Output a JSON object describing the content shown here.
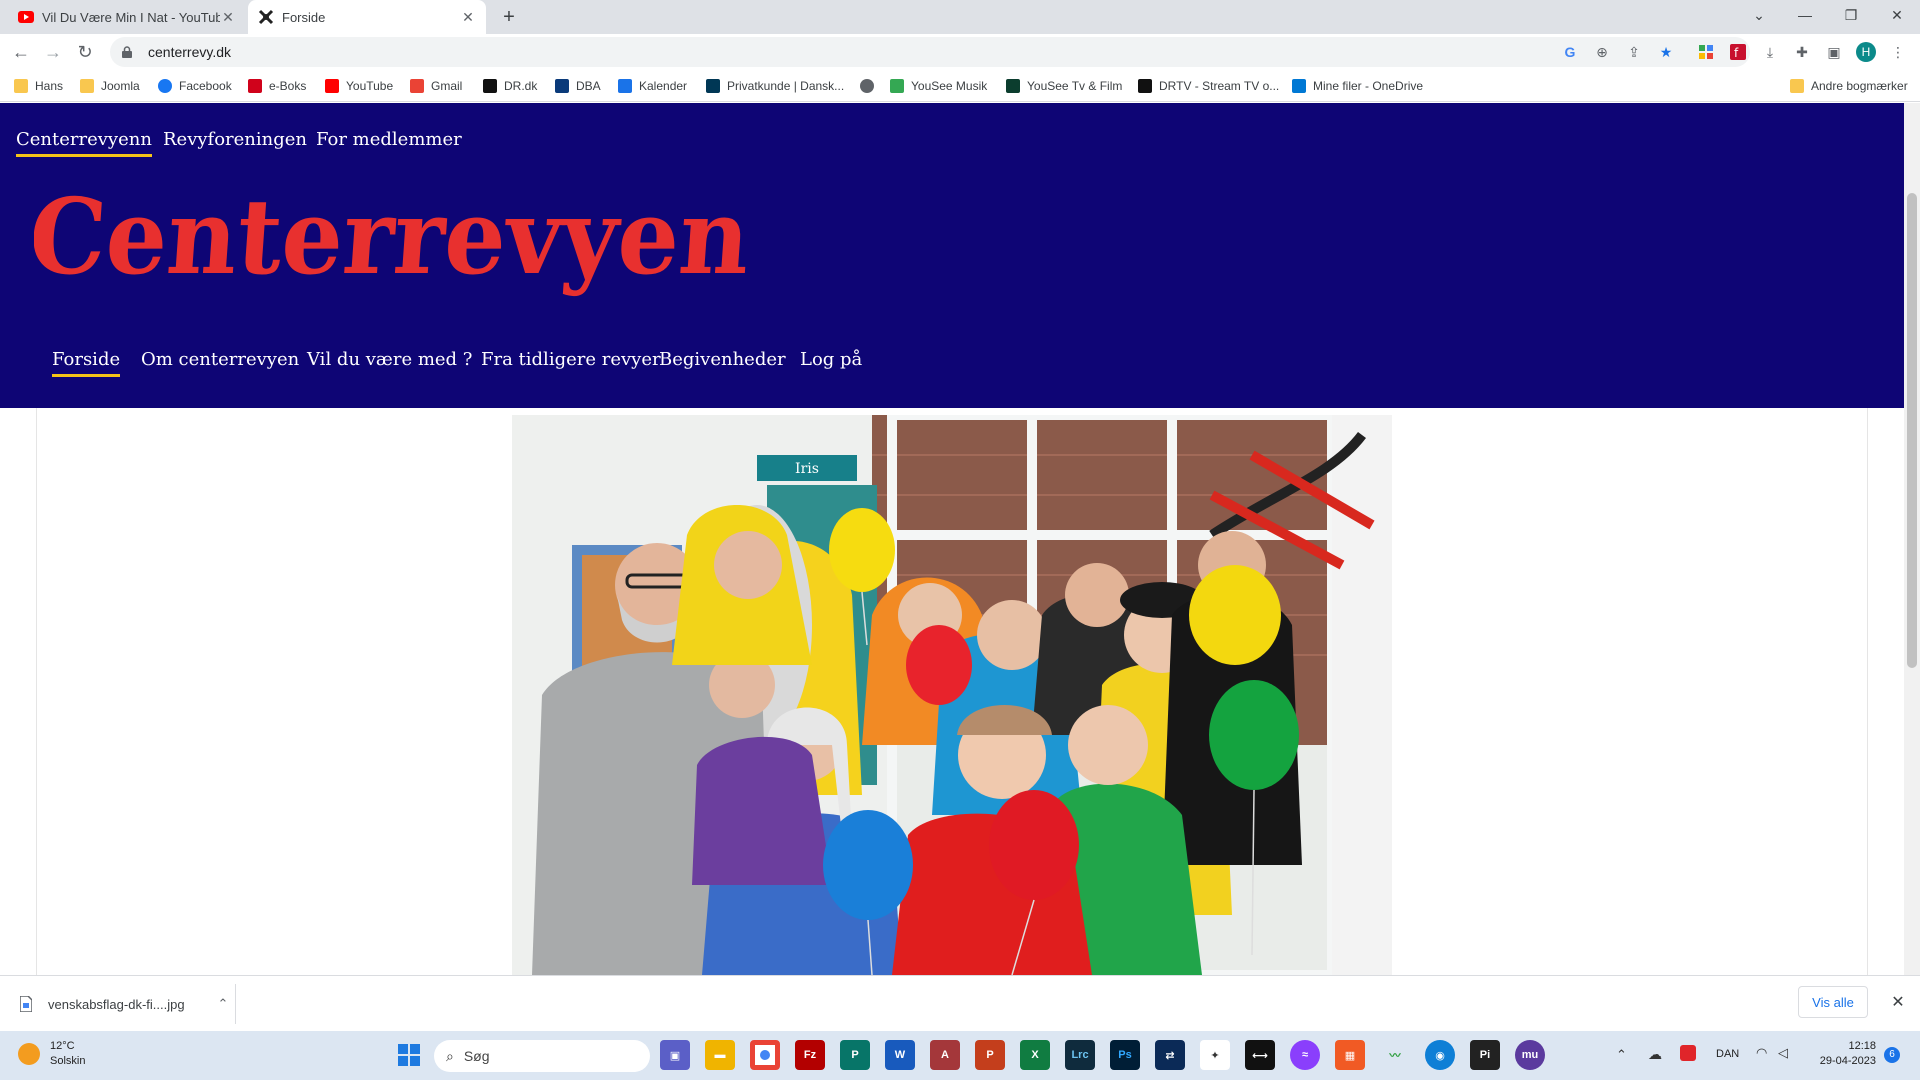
{
  "browser": {
    "tabs": [
      {
        "title": "Vil Du Være Min I Nat - YouTube",
        "favicon": "youtube-icon"
      },
      {
        "title": "Forside",
        "favicon": "site-icon"
      }
    ],
    "url": "centerrevy.dk",
    "profile_initial": "H",
    "bookmarks": [
      {
        "label": "Hans",
        "icon": "folder-icon",
        "color": "#f9c74f"
      },
      {
        "label": "Joomla",
        "icon": "folder-icon",
        "color": "#f9c74f"
      },
      {
        "label": "Facebook",
        "icon": "facebook-icon",
        "color": "#1877f2"
      },
      {
        "label": "e-Boks",
        "icon": "eboks-icon",
        "color": "#d0021b"
      },
      {
        "label": "YouTube",
        "icon": "youtube-icon",
        "color": "#ff0000"
      },
      {
        "label": "Gmail",
        "icon": "gmail-icon",
        "color": "#ea4335"
      },
      {
        "label": "DR.dk",
        "icon": "dr-icon",
        "color": "#111111"
      },
      {
        "label": "DBA",
        "icon": "dba-icon",
        "color": "#0a3a7a"
      },
      {
        "label": "Kalender",
        "icon": "calendar-icon",
        "color": "#1a73e8"
      },
      {
        "label": "Privatkunde | Dansk...",
        "icon": "bank-icon",
        "color": "#003755"
      },
      {
        "label": "",
        "icon": "globe-icon",
        "color": "#5f6368"
      },
      {
        "label": "YouSee Musik",
        "icon": "music-icon",
        "color": "#34a853"
      },
      {
        "label": "YouSee Tv & Film",
        "icon": "tv-icon",
        "color": "#0b3d2e"
      },
      {
        "label": "DRTV - Stream TV o...",
        "icon": "drtv-icon",
        "color": "#111111"
      },
      {
        "label": "Mine filer - OneDrive",
        "icon": "onedrive-icon",
        "color": "#0078d4"
      }
    ],
    "other_bookmarks": "Andre bogmærker"
  },
  "site": {
    "top_nav": [
      "Centerrevyenn",
      "Revyforeningen",
      "For medlemmer"
    ],
    "logo_text": "Centerrevyen",
    "main_nav": [
      "Forside",
      "Om centerrevyen",
      "Vil du være med ?",
      "Fra tidligere revyer",
      "Begivenheder",
      "Log på"
    ],
    "photo_sign": "Iris",
    "colors": {
      "header_bg": "#0e0575",
      "logo": "#e8302f",
      "underline": "#f5c518"
    }
  },
  "download": {
    "filename": "venskabsflag-dk-fi....jpg",
    "show_all": "Vis alle"
  },
  "taskbar": {
    "weather_temp": "12°C",
    "weather_desc": "Solskin",
    "search_placeholder": "Søg",
    "language": "DAN",
    "time": "12:18",
    "date": "29-04-2023",
    "notifications": "6"
  }
}
